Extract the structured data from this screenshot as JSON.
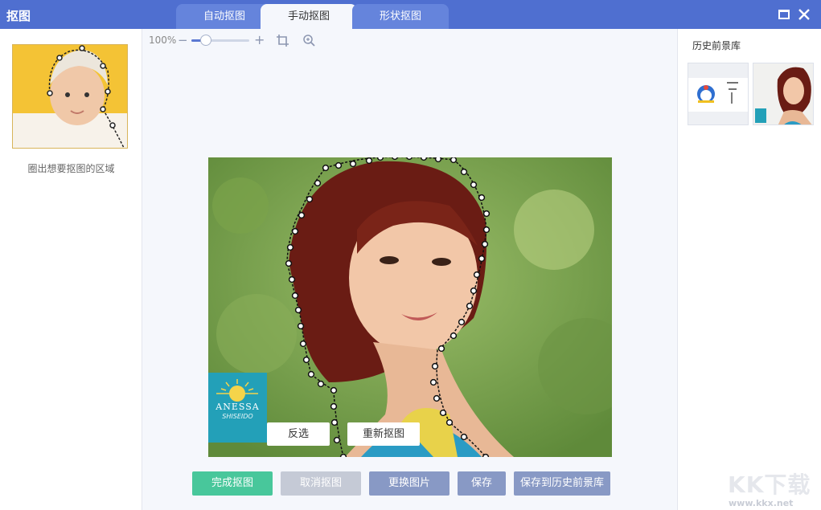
{
  "app": {
    "title": "抠图"
  },
  "tabs": [
    {
      "label": "自动抠图",
      "active": false
    },
    {
      "label": "手动抠图",
      "active": true
    },
    {
      "label": "形状抠图",
      "active": false
    }
  ],
  "window": {
    "maximize_icon": "maximize-icon",
    "close_icon": "close-icon"
  },
  "left_panel": {
    "hint": "圈出想要抠图的区域"
  },
  "right_panel": {
    "title": "历史前景库"
  },
  "toolbar": {
    "zoom": "100%",
    "zoom_level": 0.25,
    "minus": "−",
    "plus": "+"
  },
  "canvas": {
    "logo_text": "ANESSA",
    "logo_sub": "SHISEIDO",
    "invert_label": "反选",
    "redo_label": "重新抠图"
  },
  "buttons": {
    "finish": "完成抠图",
    "cancel": "取消抠图",
    "replace": "更换图片",
    "save": "保存",
    "save_history": "保存到历史前景库"
  },
  "colors": {
    "titlebar": "#4f6fd0",
    "finish": "#48c79b",
    "cancel": "#c5cad6",
    "secondary": "#8899c5"
  },
  "watermark": {
    "text": "KK下载",
    "url": "www.kkx.net"
  }
}
